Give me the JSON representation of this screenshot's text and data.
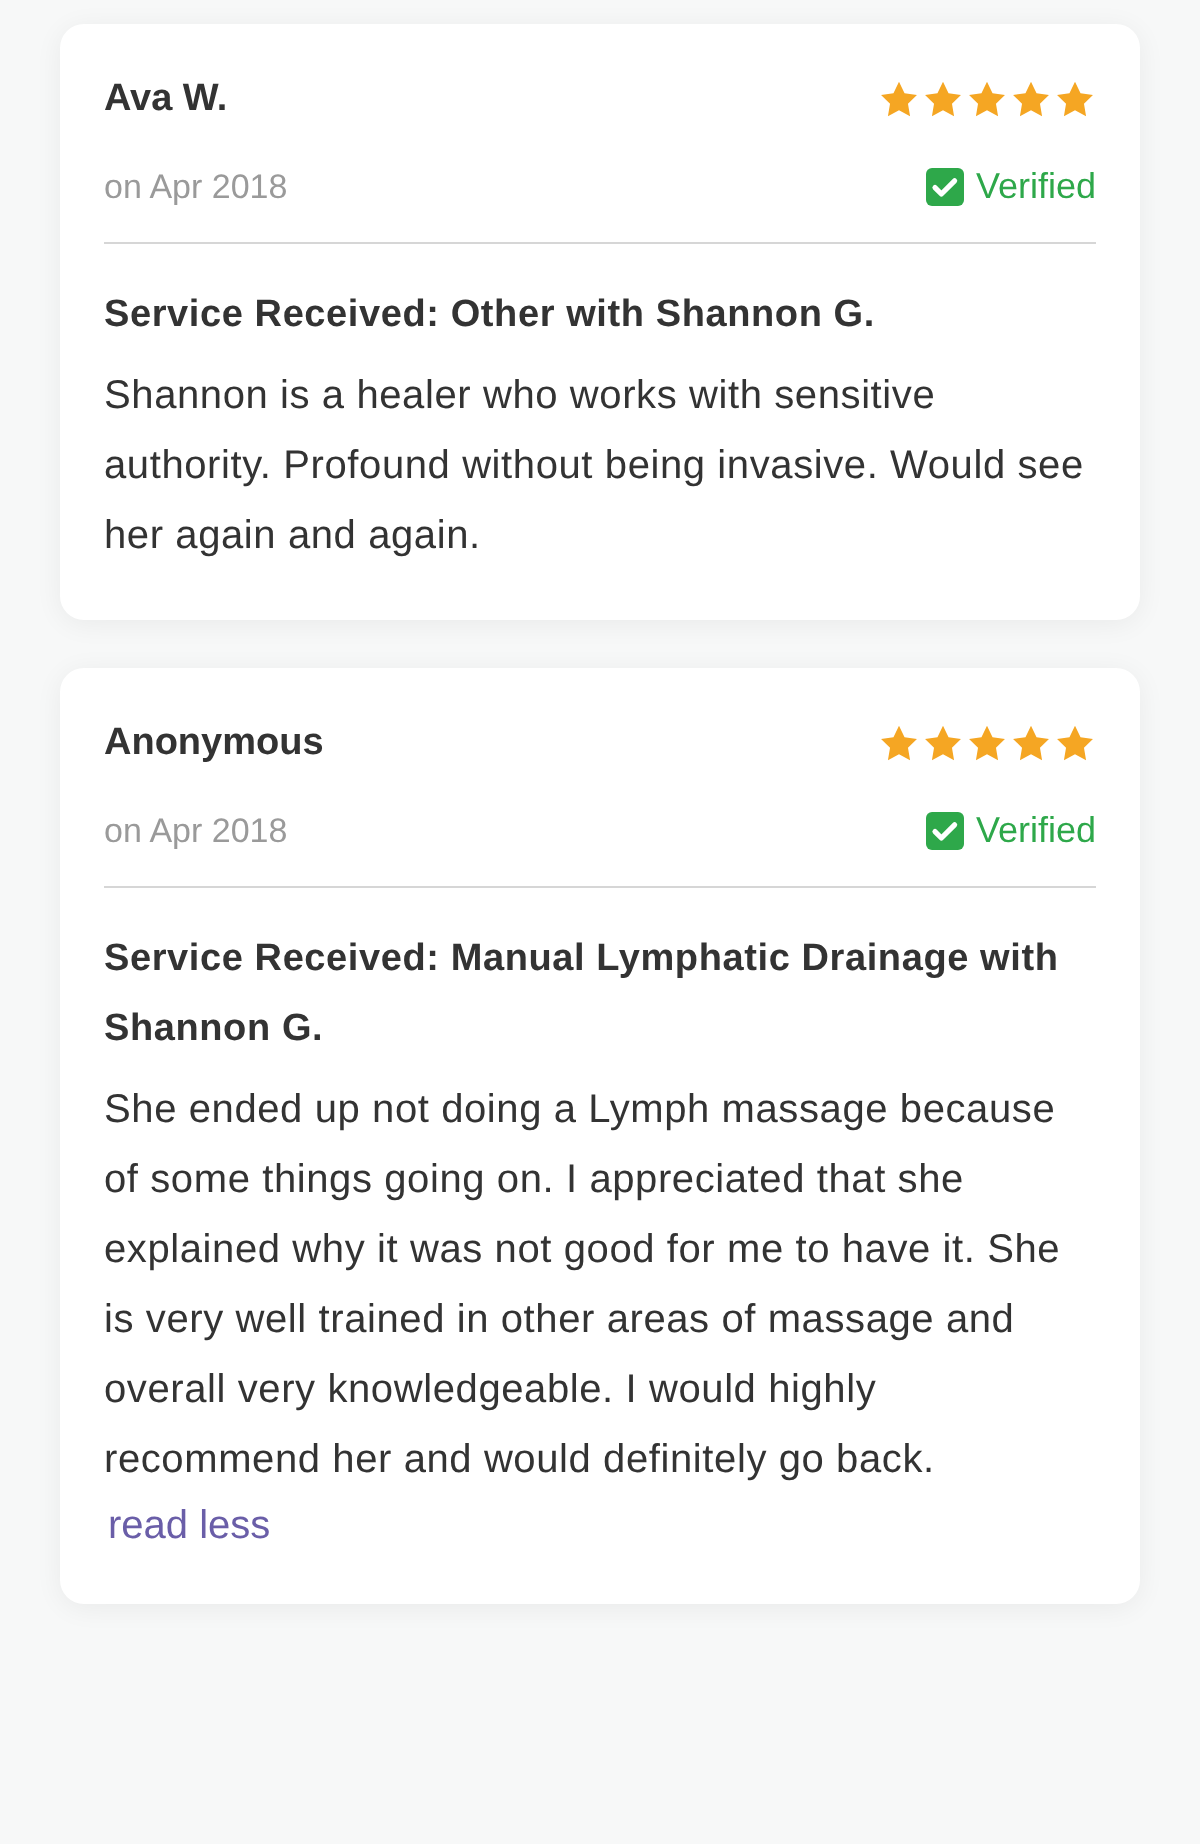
{
  "reviews": [
    {
      "name": "Ava W.",
      "date": "on Apr 2018",
      "stars": 5,
      "verified": true,
      "verified_label": "Verified",
      "service": "Service Received: Other with Shannon G.",
      "text": "Shannon is a healer who works with sensitive authority. Profound without being invasive. Would see her again and again."
    },
    {
      "name": "Anonymous",
      "date": "on Apr 2018",
      "stars": 5,
      "verified": true,
      "verified_label": "Verified",
      "service": "Service Received: Manual Lymphatic Drainage with Shannon G.",
      "text": "She ended up not doing a Lymph massage because of some things going on. I appreciated that she explained why it was not good for me to have it. She is very well trained in other areas of massage and overall very knowledgeable. I would highly recommend her and would definitely go back.",
      "link": "read less"
    }
  ]
}
